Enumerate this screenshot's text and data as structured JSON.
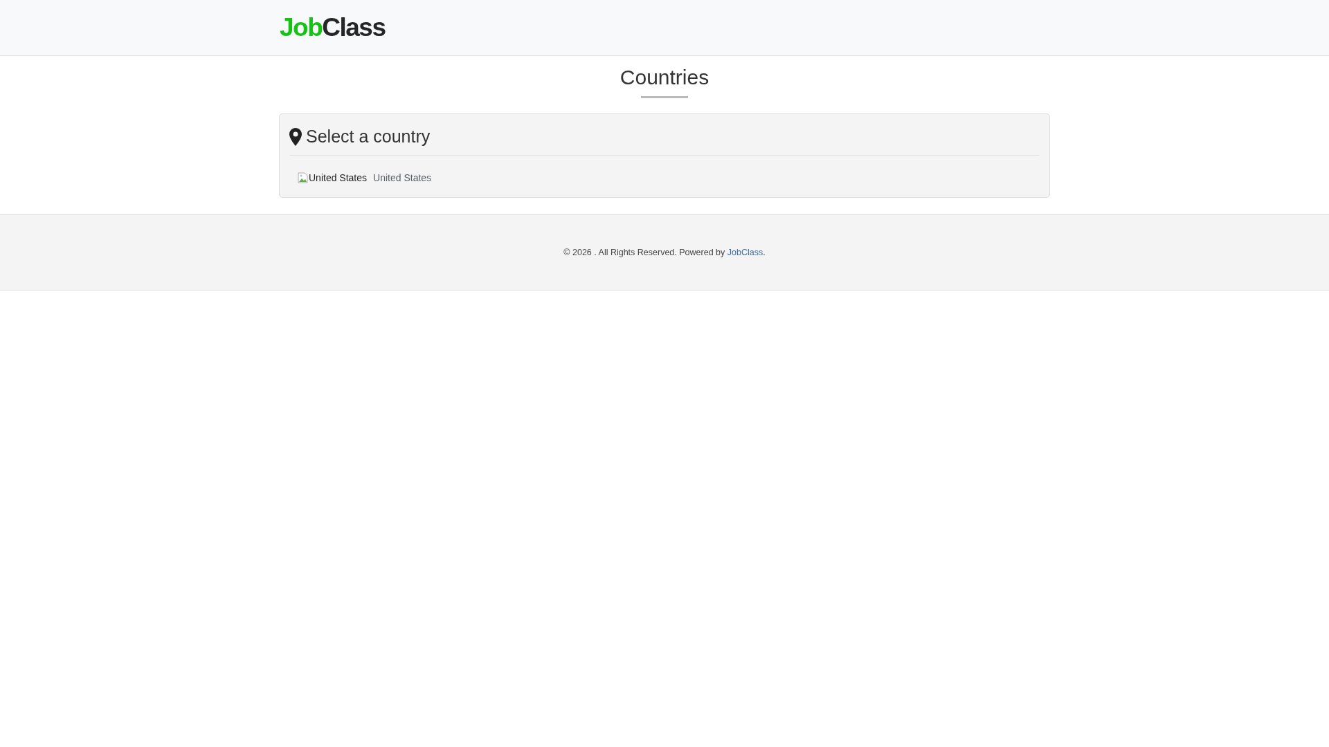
{
  "header": {
    "logo": {
      "accent": "Job",
      "rest": "Class"
    }
  },
  "page_title": "Countries",
  "card": {
    "title": "Select a country",
    "countries": [
      {
        "flag_alt": "United States",
        "name": "United States"
      }
    ]
  },
  "footer": {
    "text": "© 2026 . All Rights Reserved. Powered by",
    "link": "JobClass",
    "end": "."
  }
}
